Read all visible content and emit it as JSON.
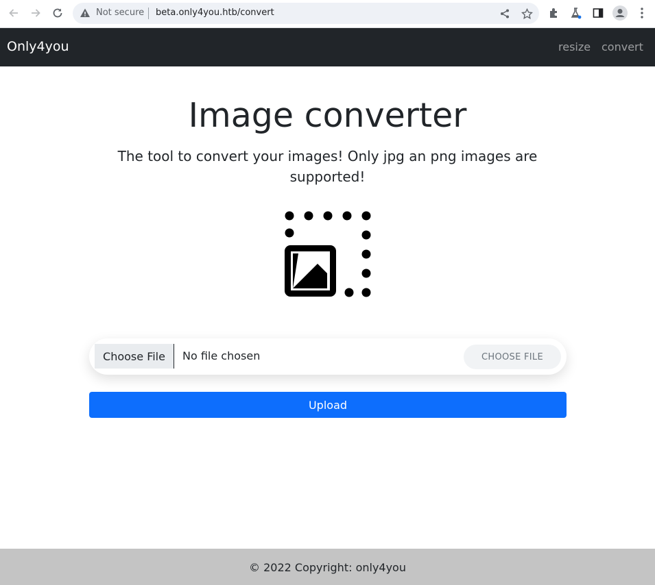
{
  "browser": {
    "not_secure": "Not secure",
    "url": "beta.only4you.htb/convert"
  },
  "navbar": {
    "brand": "Only4you",
    "links": [
      {
        "label": "resize"
      },
      {
        "label": "convert"
      }
    ]
  },
  "main": {
    "title": "Image converter",
    "subtitle": "The tool to convert your images! Only jpg an png images are supported!",
    "file_input": {
      "button_label": "Choose File",
      "status": "No file chosen",
      "choose_label": "CHOOSE FILE"
    },
    "upload_label": "Upload"
  },
  "footer": {
    "text": "© 2022 Copyright: only4you"
  },
  "colors": {
    "navbar_bg": "#212529",
    "primary": "#0d6efd",
    "footer_bg": "#c4c4c4"
  }
}
